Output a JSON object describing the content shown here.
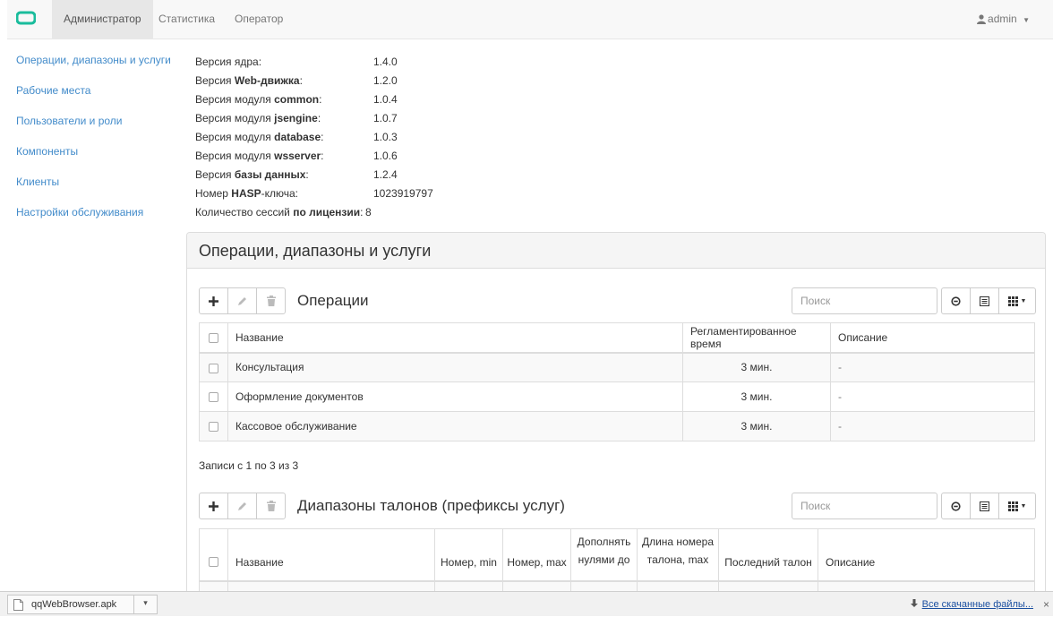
{
  "navbar": {
    "tabs": [
      {
        "label": "Администратор",
        "active": true
      },
      {
        "label": "Статистика",
        "active": false
      },
      {
        "label": "Оператор",
        "active": false
      }
    ],
    "user": "admin",
    "brand_color": "#1abc9c"
  },
  "sidebar": {
    "items": [
      "Операции, диапазоны и услуги",
      "Рабочие места",
      "Пользователи и роли",
      "Компоненты",
      "Клиенты",
      "Настройки обслуживания"
    ]
  },
  "info": [
    {
      "pre": "Версия ядра:",
      "bold": "",
      "post": "",
      "value": "1.4.0"
    },
    {
      "pre": "Версия ",
      "bold": "Web-движка",
      "post": ":",
      "value": "1.2.0"
    },
    {
      "pre": "Версия модуля ",
      "bold": "common",
      "post": ":",
      "value": "1.0.4"
    },
    {
      "pre": "Версия модуля ",
      "bold": "jsengine",
      "post": ":",
      "value": "1.0.7"
    },
    {
      "pre": "Версия модуля ",
      "bold": "database",
      "post": ":",
      "value": "1.0.3"
    },
    {
      "pre": "Версия модуля ",
      "bold": "wsserver",
      "post": ":",
      "value": "1.0.6"
    },
    {
      "pre": "Версия ",
      "bold": "базы данных",
      "post": ":",
      "value": "1.2.4"
    },
    {
      "pre": "Номер ",
      "bold": "HASP",
      "post": "-ключа:",
      "value": "1023919797"
    },
    {
      "pre": "Количество сессий ",
      "bold": "по лицензии",
      "post": ":",
      "value": "8"
    }
  ],
  "panel": {
    "title": "Операции, диапазоны и услуги",
    "operations": {
      "title": "Операции",
      "search_placeholder": "Поиск",
      "columns": [
        "Название",
        "Регламентированное время",
        "Описание"
      ],
      "rows": [
        [
          "Консультация",
          "3 мин.",
          "-"
        ],
        [
          "Оформление документов",
          "3 мин.",
          "-"
        ],
        [
          "Кассовое обслуживание",
          "3 мин.",
          "-"
        ]
      ],
      "records": "Записи с 1 по 3 из 3"
    },
    "ranges": {
      "title": "Диапазоны талонов (префиксы услуг)",
      "search_placeholder": "Поиск",
      "columns": [
        {
          "l1": "",
          "l2": "Название"
        },
        {
          "l1": "",
          "l2": "Номер, min"
        },
        {
          "l1": "",
          "l2": "Номер, max"
        },
        {
          "l1": "Дополнять",
          "l2": "нулями до"
        },
        {
          "l1": "Длина номера",
          "l2": "талона, max"
        },
        {
          "l1": "",
          "l2": "Последний талон"
        },
        {
          "l1": "",
          "l2": "Описание"
        }
      ]
    }
  },
  "download_bar": {
    "file": "qqWebBrowser.apk",
    "all_label": "Все скачанные файлы...",
    "close": "×"
  }
}
